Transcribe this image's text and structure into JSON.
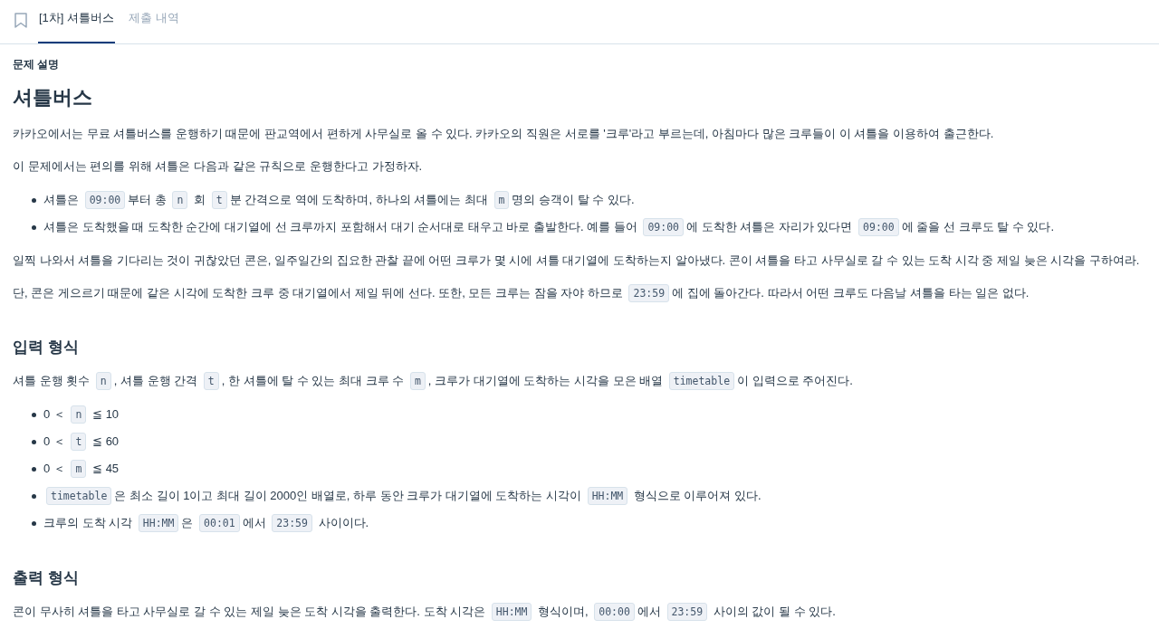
{
  "tabs": [
    {
      "label": "[1차] 셔틀버스",
      "selected": true
    },
    {
      "label": "제출 내역",
      "selected": false
    }
  ],
  "section_label": "문제 설명",
  "title": "셔틀버스",
  "blocks": [
    {
      "kind": "paragraph",
      "segments": [
        {
          "kind": "text",
          "text": "카카오에서는 무료 셔틀버스를 운행하기 때문에 판교역에서 편하게 사무실로 올 수 있다. 카카오의 직원은 서로를 '크루'라고 부르는데, 아침마다 많은 크루들이 이 셔틀을 이용하여 출근한다."
        }
      ]
    },
    {
      "kind": "paragraph",
      "segments": [
        {
          "kind": "text",
          "text": "이 문제에서는 편의를 위해 셔틀은 다음과 같은 규칙으로 운행한다고 가정하자."
        }
      ]
    },
    {
      "kind": "list",
      "items": [
        {
          "segments": [
            {
              "kind": "text",
              "text": "셔틀은 "
            },
            {
              "kind": "code",
              "text": "09:00"
            },
            {
              "kind": "text",
              "text": "부터 총 "
            },
            {
              "kind": "code",
              "text": "n"
            },
            {
              "kind": "text",
              "text": " 회 "
            },
            {
              "kind": "code",
              "text": "t"
            },
            {
              "kind": "text",
              "text": "분 간격으로 역에 도착하며, 하나의 셔틀에는 최대 "
            },
            {
              "kind": "code",
              "text": "m"
            },
            {
              "kind": "text",
              "text": "명의 승객이 탈 수 있다."
            }
          ]
        },
        {
          "segments": [
            {
              "kind": "text",
              "text": "셔틀은 도착했을 때 도착한 순간에 대기열에 선 크루까지 포함해서 대기 순서대로 태우고 바로 출발한다. 예를 들어 "
            },
            {
              "kind": "code",
              "text": "09:00"
            },
            {
              "kind": "text",
              "text": "에 도착한 셔틀은 자리가 있다면 "
            },
            {
              "kind": "code",
              "text": "09:00"
            },
            {
              "kind": "text",
              "text": "에 줄을 선 크루도 탈 수 있다."
            }
          ]
        }
      ]
    },
    {
      "kind": "paragraph",
      "segments": [
        {
          "kind": "text",
          "text": "일찍 나와서 셔틀을 기다리는 것이 귀찮았던 콘은, 일주일간의 집요한 관찰 끝에 어떤 크루가 몇 시에 셔틀 대기열에 도착하는지 알아냈다. 콘이 셔틀을 타고 사무실로 갈 수 있는 도착 시각 중 제일 늦은 시각을 구하여라."
        }
      ]
    },
    {
      "kind": "paragraph",
      "segments": [
        {
          "kind": "text",
          "text": "단, 콘은 게으르기 때문에 같은 시각에 도착한 크루 중 대기열에서 제일 뒤에 선다. 또한, 모든 크루는 잠을 자야 하므로 "
        },
        {
          "kind": "code",
          "text": "23:59"
        },
        {
          "kind": "text",
          "text": "에 집에 돌아간다. 따라서 어떤 크루도 다음날 셔틀을 타는 일은 없다."
        }
      ]
    },
    {
      "kind": "heading",
      "text": "입력 형식"
    },
    {
      "kind": "paragraph",
      "segments": [
        {
          "kind": "text",
          "text": "셔틀 운행 횟수 "
        },
        {
          "kind": "code",
          "text": "n"
        },
        {
          "kind": "text",
          "text": ", 셔틀 운행 간격 "
        },
        {
          "kind": "code",
          "text": "t"
        },
        {
          "kind": "text",
          "text": ", 한 셔틀에 탈 수 있는 최대 크루 수 "
        },
        {
          "kind": "code",
          "text": "m"
        },
        {
          "kind": "text",
          "text": ", 크루가 대기열에 도착하는 시각을 모은 배열 "
        },
        {
          "kind": "code",
          "text": "timetable"
        },
        {
          "kind": "text",
          "text": "이 입력으로 주어진다."
        }
      ]
    },
    {
      "kind": "list",
      "items": [
        {
          "segments": [
            {
              "kind": "text",
              "text": "0 ＜ "
            },
            {
              "kind": "code",
              "text": "n"
            },
            {
              "kind": "text",
              "text": " ≦ 10"
            }
          ]
        },
        {
          "segments": [
            {
              "kind": "text",
              "text": "0 ＜ "
            },
            {
              "kind": "code",
              "text": "t"
            },
            {
              "kind": "text",
              "text": " ≦ 60"
            }
          ]
        },
        {
          "segments": [
            {
              "kind": "text",
              "text": "0 ＜ "
            },
            {
              "kind": "code",
              "text": "m"
            },
            {
              "kind": "text",
              "text": " ≦ 45"
            }
          ]
        },
        {
          "segments": [
            {
              "kind": "code",
              "text": "timetable"
            },
            {
              "kind": "text",
              "text": "은 최소 길이 1이고 최대 길이 2000인 배열로, 하루 동안 크루가 대기열에 도착하는 시각이 "
            },
            {
              "kind": "code",
              "text": "HH:MM"
            },
            {
              "kind": "text",
              "text": " 형식으로 이루어져 있다."
            }
          ]
        },
        {
          "segments": [
            {
              "kind": "text",
              "text": "크루의 도착 시각 "
            },
            {
              "kind": "code",
              "text": "HH:MM"
            },
            {
              "kind": "text",
              "text": "은 "
            },
            {
              "kind": "code",
              "text": "00:01"
            },
            {
              "kind": "text",
              "text": "에서 "
            },
            {
              "kind": "code",
              "text": "23:59"
            },
            {
              "kind": "text",
              "text": " 사이이다."
            }
          ]
        }
      ]
    },
    {
      "kind": "heading",
      "text": "출력 형식"
    },
    {
      "kind": "paragraph",
      "segments": [
        {
          "kind": "text",
          "text": "콘이 무사히 셔틀을 타고 사무실로 갈 수 있는 제일 늦은 도착 시각을 출력한다. 도착 시각은 "
        },
        {
          "kind": "code",
          "text": "HH:MM"
        },
        {
          "kind": "text",
          "text": " 형식이며, "
        },
        {
          "kind": "code",
          "text": "00:00"
        },
        {
          "kind": "text",
          "text": "에서 "
        },
        {
          "kind": "code",
          "text": "23:59"
        },
        {
          "kind": "text",
          "text": " 사이의 값이 될 수 있다."
        }
      ]
    }
  ]
}
